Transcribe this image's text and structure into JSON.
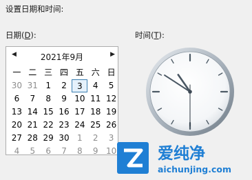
{
  "dialog": {
    "title": "设置日期和时间:"
  },
  "date_label": "日期(D):",
  "time_label": "时间(T):",
  "calendar": {
    "prev_glyph": "◀",
    "next_glyph": "▶",
    "month_label": "2021年9月",
    "weekdays": [
      "一",
      "二",
      "三",
      "四",
      "五",
      "六",
      "日"
    ],
    "weeks": [
      [
        "30",
        "31",
        "1",
        "2",
        "3",
        "4",
        "5"
      ],
      [
        "6",
        "7",
        "8",
        "9",
        "10",
        "11",
        "12"
      ],
      [
        "13",
        "14",
        "15",
        "16",
        "17",
        "18",
        "19"
      ],
      [
        "20",
        "21",
        "22",
        "23",
        "24",
        "25",
        "26"
      ],
      [
        "27",
        "28",
        "29",
        "30",
        "1",
        "2",
        "3"
      ],
      [
        "4",
        "5",
        "6",
        "7",
        "8",
        "9",
        "10"
      ]
    ],
    "selected": "3"
  },
  "clock": {
    "hour": 10,
    "minute": 50,
    "second": 30
  },
  "watermark": {
    "text": "爱纯净",
    "url": "aichunjing.com"
  }
}
